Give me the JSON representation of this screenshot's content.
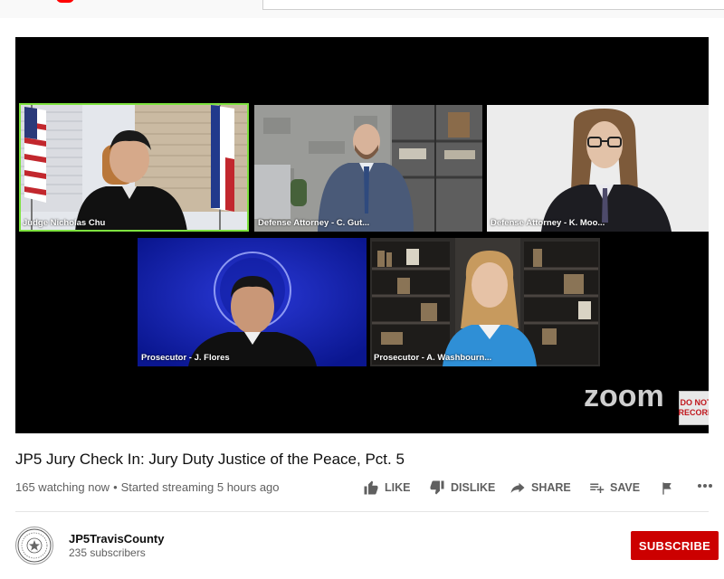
{
  "video": {
    "title": "JP5 Jury Check In: Jury Duty Justice of the Peace, Pct. 5",
    "watching": "165 watching now",
    "separator": "•",
    "started": "Started streaming 5 hours ago"
  },
  "meeting": {
    "participants": [
      {
        "label": "Judge Nicholas Chu",
        "active_speaker": true
      },
      {
        "label": "Defense Attorney - C. Gut..."
      },
      {
        "label": "Defense Attorney - K. Moo..."
      },
      {
        "label": "Prosecutor - J. Flores"
      },
      {
        "label": "Prosecutor - A. Washbourn..."
      }
    ],
    "logo_text": "zoom",
    "badge_text": [
      "DO NOT",
      "RECORD"
    ]
  },
  "actions": {
    "like": "LIKE",
    "dislike": "DISLIKE",
    "share": "SHARE",
    "save": "SAVE"
  },
  "channel": {
    "name": "JP5TravisCounty",
    "subscribers": "235 subscribers",
    "subscribe_label": "SUBSCRIBE"
  },
  "colors": {
    "active_speaker_border": "#7ee23f",
    "subscribe_bg": "#cc0000",
    "player_bg": "#000000"
  }
}
